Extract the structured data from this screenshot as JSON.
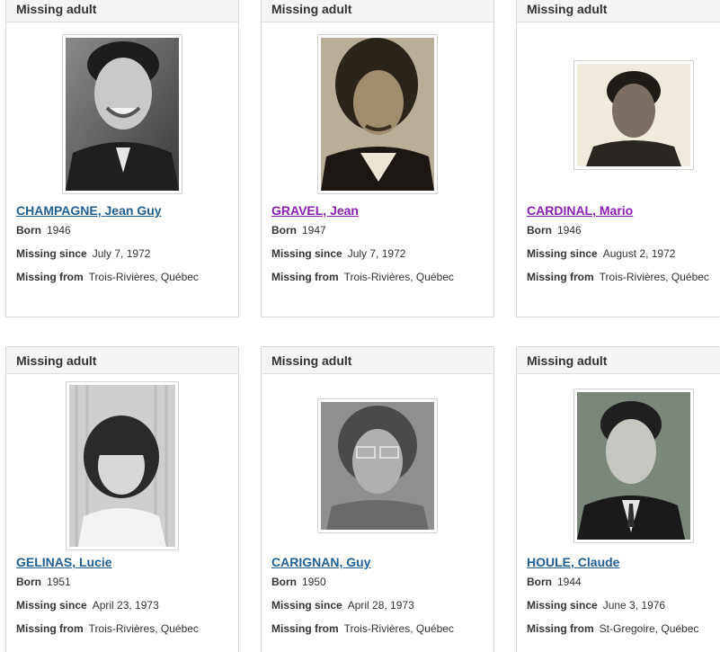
{
  "cards": [
    {
      "category": "Missing adult",
      "name": "CHAMPAGNE, Jean Guy",
      "born_label": "Born",
      "born": "1946",
      "since_label": "Missing since",
      "since": "July 7, 1972",
      "from_label": "Missing from",
      "from": "Trois-Rivières, Québec",
      "photo_tone": "#2a2a2a",
      "link_color": "#215f93"
    },
    {
      "category": "Missing adult",
      "name": "GRAVEL, Jean",
      "born_label": "Born",
      "born": "1947",
      "since_label": "Missing since",
      "since": "July 7, 1972",
      "from_label": "Missing from",
      "from": "Trois-Rivières, Québec",
      "photo_tone": "#3a3226",
      "link_color": "#8a1fb0"
    },
    {
      "category": "Missing adult",
      "name": "CARDINAL, Mario",
      "born_label": "Born",
      "born": "1946",
      "since_label": "Missing since",
      "since": "August 2, 1972",
      "from_label": "Missing from",
      "from": "Trois-Rivières, Québec",
      "photo_tone": "#f1ede0",
      "link_color": "#8a1fb0"
    },
    {
      "category": "Missing adult",
      "name": "GELINAS, Lucie",
      "born_label": "Born",
      "born": "1951",
      "since_label": "Missing since",
      "since": "April 23, 1973",
      "from_label": "Missing from",
      "from": "Trois-Rivières, Québec",
      "photo_tone": "#d9d9d9",
      "link_color": "#215f93"
    },
    {
      "category": "Missing adult",
      "name": "CARIGNAN, Guy",
      "born_label": "Born",
      "born": "1950",
      "since_label": "Missing since",
      "since": "April 28, 1973",
      "from_label": "Missing from",
      "from": "Trois-Rivières, Québec",
      "photo_tone": "#8c8c8c",
      "link_color": "#215f93"
    },
    {
      "category": "Missing adult",
      "name": "HOULE, Claude",
      "born_label": "Born",
      "born": "1944",
      "since_label": "Missing since",
      "since": "June 3, 1976",
      "from_label": "Missing from",
      "from": "St-Gregoire, Québec",
      "photo_tone": "#5e6a60",
      "link_color": "#215f93"
    }
  ]
}
